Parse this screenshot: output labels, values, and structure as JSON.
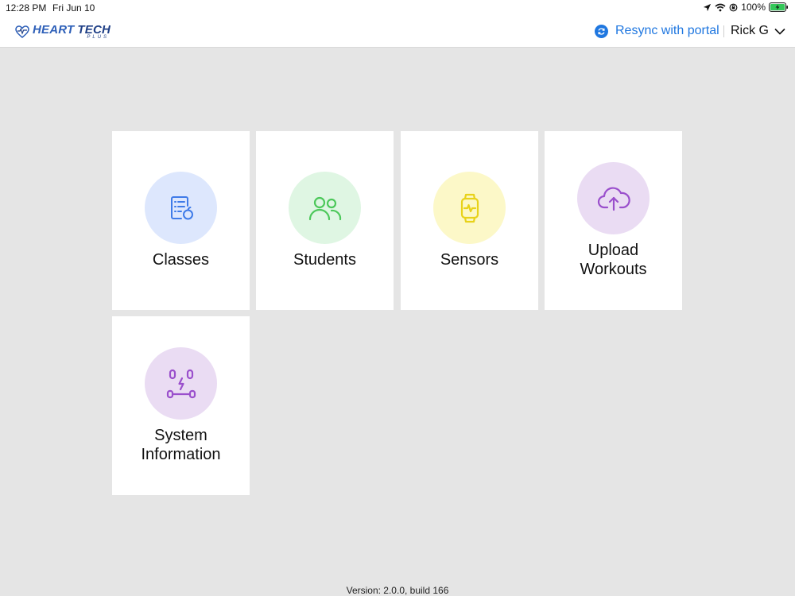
{
  "status_bar": {
    "time": "12:28 PM",
    "date": "Fri Jun 10",
    "battery": "100%"
  },
  "header": {
    "logo": {
      "main_1": "HEART",
      "main_2": "TECH",
      "sub": "PLUS"
    },
    "resync_label": "Resync with portal",
    "user_name": "Rick G"
  },
  "tiles": [
    {
      "label_1": "Classes",
      "label_2": "",
      "icon": "classes-icon",
      "circle_color": "#dde7fd",
      "icon_color": "#3f7be8"
    },
    {
      "label_1": "Students",
      "label_2": "",
      "icon": "students-icon",
      "circle_color": "#dff6e3",
      "icon_color": "#4cc85a"
    },
    {
      "label_1": "Sensors",
      "label_2": "",
      "icon": "watch-icon",
      "circle_color": "#fcf8c8",
      "icon_color": "#e8d21a"
    },
    {
      "label_1": "Upload",
      "label_2": "Workouts",
      "icon": "cloud-upload-icon",
      "circle_color": "#eadcf3",
      "icon_color": "#9a4fcc"
    },
    {
      "label_1": "System",
      "label_2": "Information",
      "icon": "system-info-icon",
      "circle_color": "#eadcf3",
      "icon_color": "#9a4fcc"
    }
  ],
  "footer": {
    "version": "Version: 2.0.0, build 166"
  },
  "colors": {
    "accent": "#1f77e0",
    "background": "#e5e5e5"
  }
}
